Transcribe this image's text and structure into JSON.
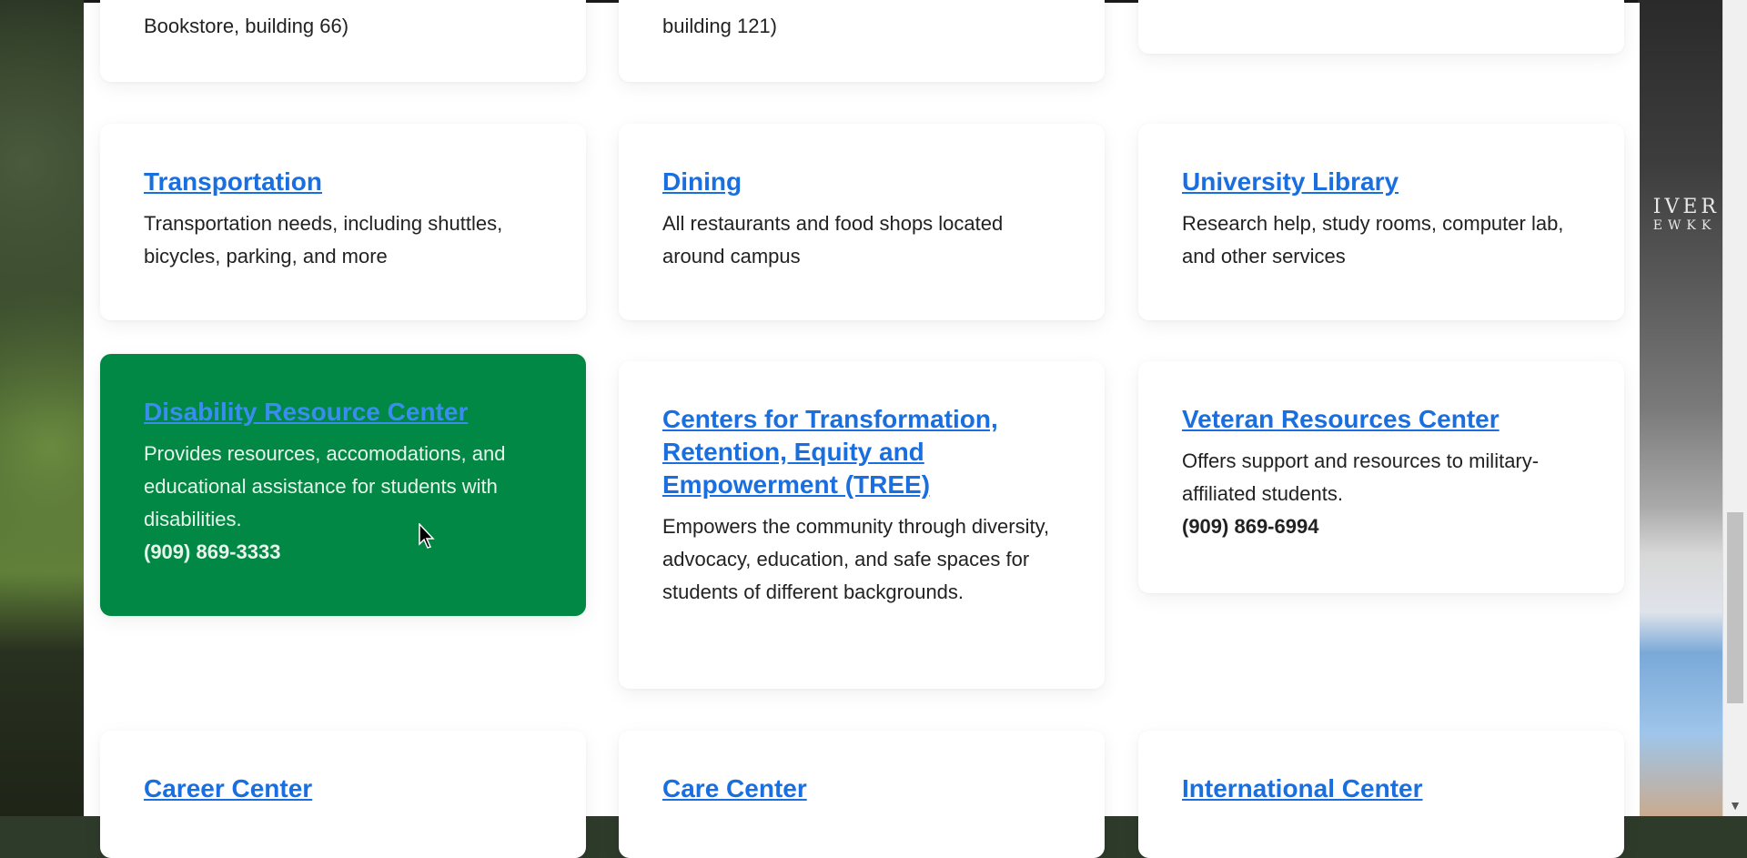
{
  "top_row": {
    "col1_tail": "Bookstore, building 66)",
    "col2_tail": "building 121)"
  },
  "cards": {
    "transportation": {
      "title": "Transportation",
      "desc": "Transportation needs, including shuttles, bicycles, parking, and more"
    },
    "dining": {
      "title": "Dining",
      "desc": "All restaurants and food shops located around campus"
    },
    "library": {
      "title": "University Library",
      "desc": "Research help, study rooms, computer lab, and other services"
    },
    "drc": {
      "title": "Disability Resource Center",
      "desc": "Provides resources, accomodations, and educational assistance for students with disabilities.",
      "phone": "(909) 869-3333"
    },
    "tree": {
      "title": "Centers for Transformation, Retention, Equity and Empowerment (TREE)",
      "desc": "Empowers the community through diversity, advocacy, education, and safe spaces for students of different backgrounds."
    },
    "veteran": {
      "title": "Veteran Resources Center",
      "desc": "Offers support and resources to military-affiliated students.",
      "phone": "(909) 869-6994"
    },
    "career": {
      "title": "Career Center"
    },
    "care": {
      "title": "Care Center"
    },
    "international": {
      "title": "International Center"
    }
  },
  "background": {
    "building_sign_line1": "IVER",
    "building_sign_line2": "EWKK"
  },
  "colors": {
    "link": "#1a6fe0",
    "active_card": "#008844",
    "text": "#222222"
  }
}
